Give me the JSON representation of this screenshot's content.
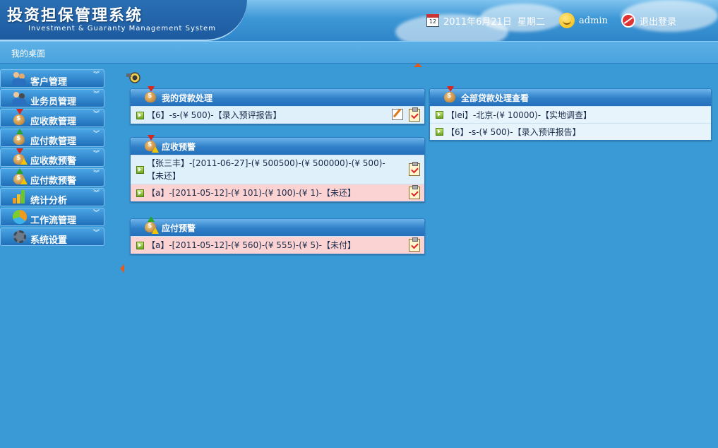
{
  "header": {
    "title": "投资担保管理系统",
    "subtitle": "Investment & Guaranty Management System",
    "date": "2011年6月21日",
    "weekday": "星期二",
    "user": "admin",
    "logout_label": "退出登录",
    "calendar_icon_text": "12"
  },
  "breadcrumb": {
    "label": "我的桌面"
  },
  "sidebar": {
    "items": [
      {
        "label": "客户管理",
        "icon": "customers-icon"
      },
      {
        "label": "业务员管理",
        "icon": "salesperson-icon"
      },
      {
        "label": "应收款管理",
        "icon": "receivable-icon"
      },
      {
        "label": "应付款管理",
        "icon": "payable-icon"
      },
      {
        "label": "应收款预警",
        "icon": "receivable-warning-icon"
      },
      {
        "label": "应付款预警",
        "icon": "payable-warning-icon"
      },
      {
        "label": "统计分析",
        "icon": "chart-icon"
      },
      {
        "label": "工作流管理",
        "icon": "workflow-icon"
      },
      {
        "label": "系统设置",
        "icon": "gear-icon"
      }
    ],
    "chevron": "⌄⌄"
  },
  "panels": {
    "my_loans": {
      "title": "我的贷款处理",
      "rows": [
        {
          "text": "【6】-s-(¥ 500)-【录入预评报告】"
        }
      ]
    },
    "receivable_warning": {
      "title": "应收预警",
      "rows": [
        {
          "text": "【张三丰】-[2011-06-27]-(¥ 500500)-(¥ 500000)-(¥ 500)-【未还】"
        },
        {
          "text": "【a】-[2011-05-12]-(¥ 101)-(¥ 100)-(¥ 1)-【未还】"
        }
      ]
    },
    "payable_warning": {
      "title": "应付预警",
      "rows": [
        {
          "text": "【a】-[2011-05-12]-(¥ 560)-(¥ 555)-(¥ 5)-【未付】"
        }
      ]
    },
    "all_loans": {
      "title": "全部贷款处理查看",
      "rows": [
        {
          "text": "【lei】-北京-(¥ 10000)-【实地调查】"
        },
        {
          "text": "【6】-s-(¥ 500)-【录入预评报告】"
        }
      ]
    }
  },
  "colors": {
    "background": "#3a9ad6",
    "panel_header": "#2f7fc8",
    "warning_row": "#fbd3d3",
    "normal_row": "#dff0fb",
    "collapse_arrow": "#e35b1a"
  }
}
